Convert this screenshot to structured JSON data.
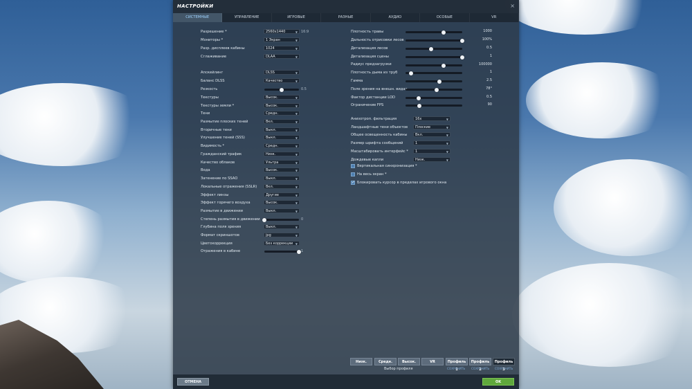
{
  "window": {
    "title": "НАСТРОЙКИ",
    "close_glyph": "×"
  },
  "tabs": [
    "СИСТЕМНЫЕ",
    "УПРАВЛЕНИЕ",
    "ИГРОВЫЕ",
    "РАЗНЫЕ",
    "АУДИО",
    "ОСОБЫЕ",
    "VR"
  ],
  "left": {
    "resolution": {
      "label": "Разрешение *",
      "value": "2560x1440",
      "note": "16:9"
    },
    "monitors": {
      "label": "Мониторы *",
      "value": "1 Экран"
    },
    "cockpit_res": {
      "label": "Разр. дисплеев кабины",
      "value": "1024"
    },
    "antialiasing": {
      "label": "Сглаживание",
      "value": "DLAA"
    },
    "upscaler": {
      "label": "Апскейлинг",
      "value": "DLSS"
    },
    "dlss_balance": {
      "label": "Баланс DLSS",
      "value": "Качество"
    },
    "sharpness": {
      "label": "Резкость",
      "value": "0.5",
      "fraction": 0.5
    },
    "textures": {
      "label": "Текстуры",
      "value": "Высок."
    },
    "ground_textures": {
      "label": "Текстуры земли *",
      "value": "Высок."
    },
    "shadows": {
      "label": "Тени",
      "value": "Средн."
    },
    "flat_shadow_blur": {
      "label": "Размытие плоских теней",
      "value": "Вкл."
    },
    "secondary_shadows": {
      "label": "Вторичные тени",
      "value": "Выкл."
    },
    "sss": {
      "label": "Улучшение теней (SSS)",
      "value": "Выкл."
    },
    "visibility": {
      "label": "Видимость *",
      "value": "Средн."
    },
    "civil_traffic": {
      "label": "Гражданский трафик",
      "value": "Низк."
    },
    "cloud_quality": {
      "label": "Качество облаков",
      "value": "Ультра"
    },
    "water": {
      "label": "Вода",
      "value": "Высок."
    },
    "ssao": {
      "label": "Затенение по SSAO",
      "value": "Выкл."
    },
    "sslr": {
      "label": "Локальные отражения (SSLR)",
      "value": "Вкл."
    },
    "lens": {
      "label": "Эффект линзы",
      "value": "Другие"
    },
    "heat_haze": {
      "label": "Эффект горячего воздуха",
      "value": "Высок."
    },
    "motion_blur": {
      "label": "Размытие в движении",
      "value": "Выкл."
    },
    "motion_blur_amount": {
      "label": "Степень размытия в движении",
      "value": "0",
      "fraction": 0.0
    },
    "dof": {
      "label": "Глубина поля зрения",
      "value": "Выкл."
    },
    "screenshot_format": {
      "label": "Формат скриншотов",
      "value": "jpg"
    },
    "color_correction": {
      "label": "Цветокоррекция",
      "value": "Без коррекции"
    },
    "cockpit_reflections": {
      "label": "Отражения в кабине",
      "value": "1",
      "fraction": 1.0
    }
  },
  "right": {
    "sliders": [
      {
        "label": "Плотность травы",
        "value": "1000",
        "fraction": 0.67
      },
      {
        "label": "Дальность отрисовки лесов",
        "value": "100%",
        "fraction": 1.0
      },
      {
        "label": "Детализация лесов",
        "value": "0.5",
        "fraction": 0.45
      },
      {
        "label": "Детализация сцены",
        "value": "1",
        "fraction": 1.0
      },
      {
        "label": "Радиус предзагрузки",
        "value": "100000",
        "fraction": 0.67
      },
      {
        "label": "Плотность дыма из труб",
        "value": "1",
        "fraction": 0.1
      },
      {
        "label": "Гамма",
        "value": "2.5",
        "fraction": 0.6
      },
      {
        "label": "Поле зрения на внешн. видах",
        "value": "78°",
        "fraction": 0.55
      },
      {
        "label": "Фактор дистанции LOD",
        "value": "0.5",
        "fraction": 0.23
      },
      {
        "label": "Ограничение FPS",
        "value": "90",
        "fraction": 0.24
      }
    ],
    "dropdowns": [
      {
        "label": "Анизотроп. фильтрация",
        "value": "16x"
      },
      {
        "label": "Ландшафтные тени объектов",
        "value": "Плоские"
      },
      {
        "label": "Общее освещенность кабины",
        "value": "Вкл."
      },
      {
        "label": "Размер шрифта сообщений",
        "value": "1"
      },
      {
        "label": "Масштабировать интерфейс *",
        "value": "1"
      },
      {
        "label": "Дождевые капли",
        "value": "Низк."
      }
    ],
    "checkboxes": [
      {
        "label": "Вертикальная синхронизация *",
        "checked": false
      },
      {
        "label": "На весь экран *",
        "checked": false
      },
      {
        "label": "Блокировать курсор в пределах игрового окна",
        "checked": true
      }
    ]
  },
  "profiles": {
    "buttons": [
      "Низк.",
      "Средн.",
      "Высок.",
      "VR",
      "Профиль 1",
      "Профиль 2",
      "Профиль 3"
    ],
    "select_label": "Выбор профиля",
    "save_label": "СОХРАНИТЬ"
  },
  "footer": {
    "cancel": "ОТМЕНА",
    "ok": "OK"
  },
  "colors": {
    "accent": "#9fd3ff",
    "ok_button": "#5fa83c",
    "panel": "#2d3a48"
  }
}
